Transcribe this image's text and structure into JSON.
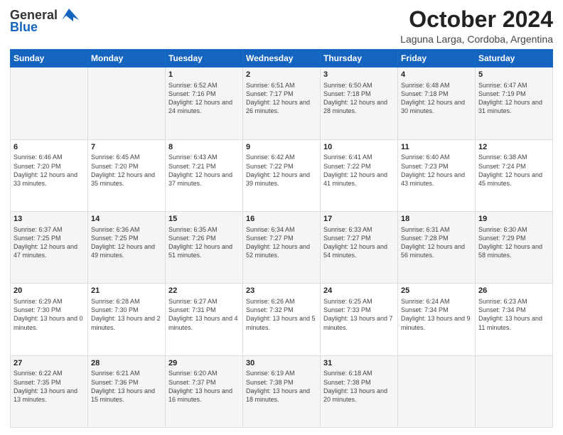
{
  "logo": {
    "general": "General",
    "blue": "Blue"
  },
  "header": {
    "month": "October 2024",
    "location": "Laguna Larga, Cordoba, Argentina"
  },
  "weekdays": [
    "Sunday",
    "Monday",
    "Tuesday",
    "Wednesday",
    "Thursday",
    "Friday",
    "Saturday"
  ],
  "weeks": [
    [
      {
        "day": "",
        "sunrise": "",
        "sunset": "",
        "daylight": ""
      },
      {
        "day": "",
        "sunrise": "",
        "sunset": "",
        "daylight": ""
      },
      {
        "day": "1",
        "sunrise": "Sunrise: 6:52 AM",
        "sunset": "Sunset: 7:16 PM",
        "daylight": "Daylight: 12 hours and 24 minutes."
      },
      {
        "day": "2",
        "sunrise": "Sunrise: 6:51 AM",
        "sunset": "Sunset: 7:17 PM",
        "daylight": "Daylight: 12 hours and 26 minutes."
      },
      {
        "day": "3",
        "sunrise": "Sunrise: 6:50 AM",
        "sunset": "Sunset: 7:18 PM",
        "daylight": "Daylight: 12 hours and 28 minutes."
      },
      {
        "day": "4",
        "sunrise": "Sunrise: 6:48 AM",
        "sunset": "Sunset: 7:18 PM",
        "daylight": "Daylight: 12 hours and 30 minutes."
      },
      {
        "day": "5",
        "sunrise": "Sunrise: 6:47 AM",
        "sunset": "Sunset: 7:19 PM",
        "daylight": "Daylight: 12 hours and 31 minutes."
      }
    ],
    [
      {
        "day": "6",
        "sunrise": "Sunrise: 6:46 AM",
        "sunset": "Sunset: 7:20 PM",
        "daylight": "Daylight: 12 hours and 33 minutes."
      },
      {
        "day": "7",
        "sunrise": "Sunrise: 6:45 AM",
        "sunset": "Sunset: 7:20 PM",
        "daylight": "Daylight: 12 hours and 35 minutes."
      },
      {
        "day": "8",
        "sunrise": "Sunrise: 6:43 AM",
        "sunset": "Sunset: 7:21 PM",
        "daylight": "Daylight: 12 hours and 37 minutes."
      },
      {
        "day": "9",
        "sunrise": "Sunrise: 6:42 AM",
        "sunset": "Sunset: 7:22 PM",
        "daylight": "Daylight: 12 hours and 39 minutes."
      },
      {
        "day": "10",
        "sunrise": "Sunrise: 6:41 AM",
        "sunset": "Sunset: 7:22 PM",
        "daylight": "Daylight: 12 hours and 41 minutes."
      },
      {
        "day": "11",
        "sunrise": "Sunrise: 6:40 AM",
        "sunset": "Sunset: 7:23 PM",
        "daylight": "Daylight: 12 hours and 43 minutes."
      },
      {
        "day": "12",
        "sunrise": "Sunrise: 6:38 AM",
        "sunset": "Sunset: 7:24 PM",
        "daylight": "Daylight: 12 hours and 45 minutes."
      }
    ],
    [
      {
        "day": "13",
        "sunrise": "Sunrise: 6:37 AM",
        "sunset": "Sunset: 7:25 PM",
        "daylight": "Daylight: 12 hours and 47 minutes."
      },
      {
        "day": "14",
        "sunrise": "Sunrise: 6:36 AM",
        "sunset": "Sunset: 7:25 PM",
        "daylight": "Daylight: 12 hours and 49 minutes."
      },
      {
        "day": "15",
        "sunrise": "Sunrise: 6:35 AM",
        "sunset": "Sunset: 7:26 PM",
        "daylight": "Daylight: 12 hours and 51 minutes."
      },
      {
        "day": "16",
        "sunrise": "Sunrise: 6:34 AM",
        "sunset": "Sunset: 7:27 PM",
        "daylight": "Daylight: 12 hours and 52 minutes."
      },
      {
        "day": "17",
        "sunrise": "Sunrise: 6:33 AM",
        "sunset": "Sunset: 7:27 PM",
        "daylight": "Daylight: 12 hours and 54 minutes."
      },
      {
        "day": "18",
        "sunrise": "Sunrise: 6:31 AM",
        "sunset": "Sunset: 7:28 PM",
        "daylight": "Daylight: 12 hours and 56 minutes."
      },
      {
        "day": "19",
        "sunrise": "Sunrise: 6:30 AM",
        "sunset": "Sunset: 7:29 PM",
        "daylight": "Daylight: 12 hours and 58 minutes."
      }
    ],
    [
      {
        "day": "20",
        "sunrise": "Sunrise: 6:29 AM",
        "sunset": "Sunset: 7:30 PM",
        "daylight": "Daylight: 13 hours and 0 minutes."
      },
      {
        "day": "21",
        "sunrise": "Sunrise: 6:28 AM",
        "sunset": "Sunset: 7:30 PM",
        "daylight": "Daylight: 13 hours and 2 minutes."
      },
      {
        "day": "22",
        "sunrise": "Sunrise: 6:27 AM",
        "sunset": "Sunset: 7:31 PM",
        "daylight": "Daylight: 13 hours and 4 minutes."
      },
      {
        "day": "23",
        "sunrise": "Sunrise: 6:26 AM",
        "sunset": "Sunset: 7:32 PM",
        "daylight": "Daylight: 13 hours and 5 minutes."
      },
      {
        "day": "24",
        "sunrise": "Sunrise: 6:25 AM",
        "sunset": "Sunset: 7:33 PM",
        "daylight": "Daylight: 13 hours and 7 minutes."
      },
      {
        "day": "25",
        "sunrise": "Sunrise: 6:24 AM",
        "sunset": "Sunset: 7:34 PM",
        "daylight": "Daylight: 13 hours and 9 minutes."
      },
      {
        "day": "26",
        "sunrise": "Sunrise: 6:23 AM",
        "sunset": "Sunset: 7:34 PM",
        "daylight": "Daylight: 13 hours and 11 minutes."
      }
    ],
    [
      {
        "day": "27",
        "sunrise": "Sunrise: 6:22 AM",
        "sunset": "Sunset: 7:35 PM",
        "daylight": "Daylight: 13 hours and 13 minutes."
      },
      {
        "day": "28",
        "sunrise": "Sunrise: 6:21 AM",
        "sunset": "Sunset: 7:36 PM",
        "daylight": "Daylight: 13 hours and 15 minutes."
      },
      {
        "day": "29",
        "sunrise": "Sunrise: 6:20 AM",
        "sunset": "Sunset: 7:37 PM",
        "daylight": "Daylight: 13 hours and 16 minutes."
      },
      {
        "day": "30",
        "sunrise": "Sunrise: 6:19 AM",
        "sunset": "Sunset: 7:38 PM",
        "daylight": "Daylight: 13 hours and 18 minutes."
      },
      {
        "day": "31",
        "sunrise": "Sunrise: 6:18 AM",
        "sunset": "Sunset: 7:38 PM",
        "daylight": "Daylight: 13 hours and 20 minutes."
      },
      {
        "day": "",
        "sunrise": "",
        "sunset": "",
        "daylight": ""
      },
      {
        "day": "",
        "sunrise": "",
        "sunset": "",
        "daylight": ""
      }
    ]
  ]
}
